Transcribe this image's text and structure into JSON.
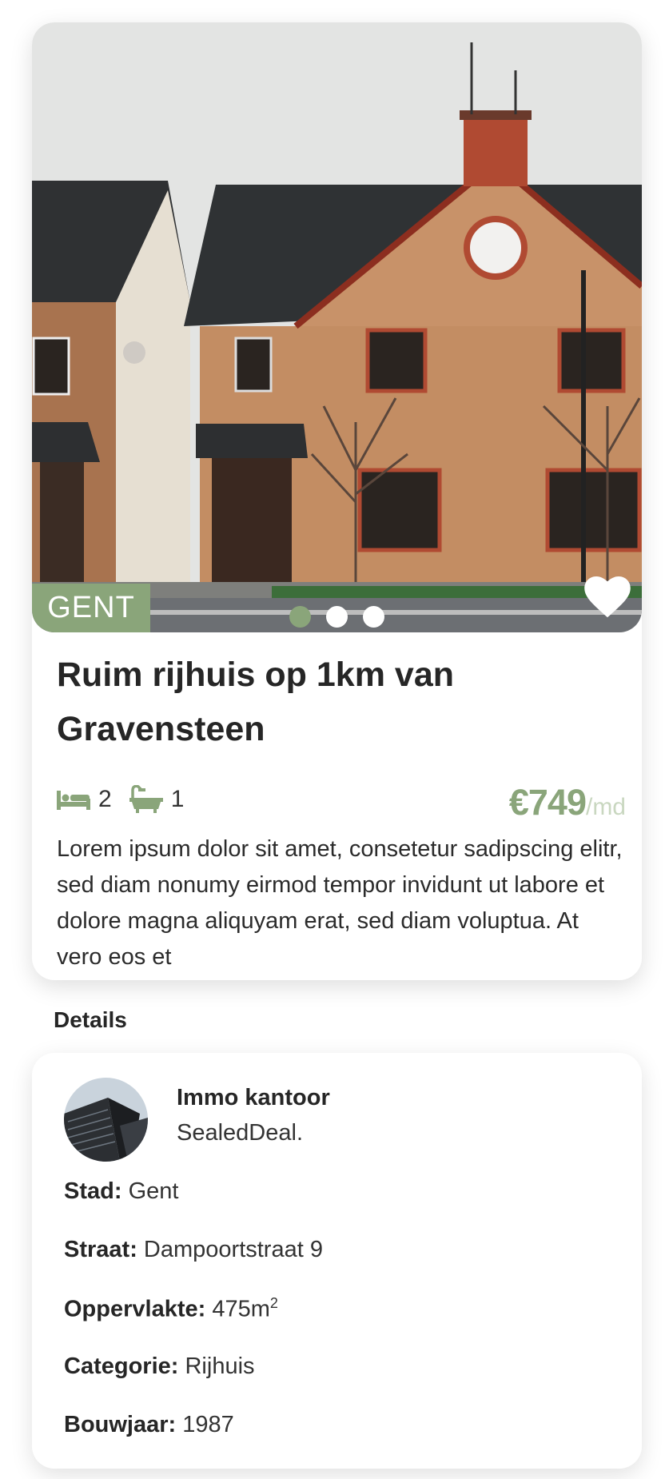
{
  "listing": {
    "city_badge": "GENT",
    "title": "Ruim rijhuis op 1km van Gravensteen",
    "bedrooms": "2",
    "bathrooms": "1",
    "price": "€749",
    "price_unit": "/md",
    "description": "Lorem ipsum dolor sit amet, consetetur sadipscing elitr, sed diam nonumy eirmod tempor invidunt ut labore et dolore magna aliquyam erat, sed diam voluptua. At vero eos et",
    "carousel": {
      "total": 3,
      "active_index": 0
    },
    "favorite": true
  },
  "details": {
    "heading": "Details",
    "agent_label": "Immo kantoor",
    "agent_name": "SealedDeal.",
    "rows": [
      {
        "label": "Stad:",
        "value": "Gent"
      },
      {
        "label": "Straat:",
        "value": "Dampoortstraat 9"
      },
      {
        "label": "Oppervlakte:",
        "value": "475m",
        "sup": "2"
      },
      {
        "label": "Categorie:",
        "value": "Rijhuis"
      },
      {
        "label": "Bouwjaar:",
        "value": "1987"
      }
    ]
  },
  "colors": {
    "accent": "#8aa57a",
    "accent_light": "#c9d7c0",
    "text": "#262626"
  },
  "icons": [
    "bed-icon",
    "bathtub-icon",
    "heart-icon"
  ]
}
